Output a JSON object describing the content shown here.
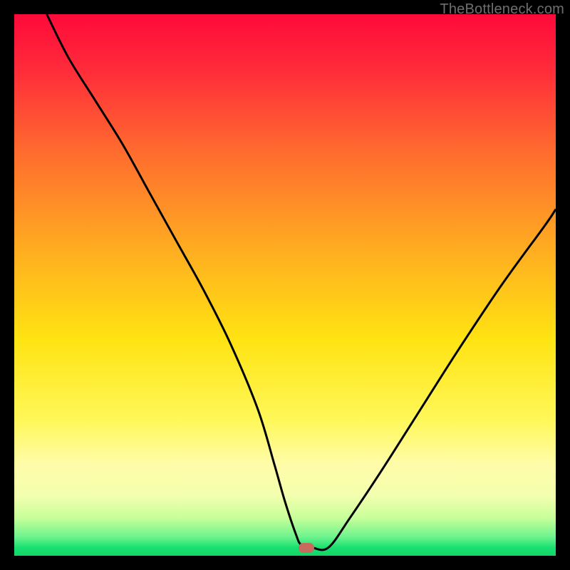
{
  "watermark": {
    "text": "TheBottleneck.com",
    "color": "#6f6f6f"
  },
  "chart_data": {
    "type": "line",
    "title": "",
    "xlabel": "",
    "ylabel": "",
    "xlim": [
      0,
      100
    ],
    "ylim": [
      0,
      100
    ],
    "grid": false,
    "legend": false,
    "gradient_stops": [
      {
        "pos": 0.0,
        "color": "#ff0a3a"
      },
      {
        "pos": 0.1,
        "color": "#ff2a3a"
      },
      {
        "pos": 0.25,
        "color": "#ff6a2f"
      },
      {
        "pos": 0.45,
        "color": "#ffb21f"
      },
      {
        "pos": 0.6,
        "color": "#ffe312"
      },
      {
        "pos": 0.75,
        "color": "#fff85a"
      },
      {
        "pos": 0.83,
        "color": "#fffca8"
      },
      {
        "pos": 0.89,
        "color": "#f2ffae"
      },
      {
        "pos": 0.93,
        "color": "#c8ff9a"
      },
      {
        "pos": 0.965,
        "color": "#6ef38d"
      },
      {
        "pos": 0.985,
        "color": "#18e06f"
      },
      {
        "pos": 1.0,
        "color": "#11d769"
      }
    ],
    "series": [
      {
        "name": "bottleneck-curve",
        "color": "#000000",
        "stroke_width": 3,
        "x": [
          6,
          10,
          15,
          20,
          25,
          30,
          35,
          40,
          45,
          48,
          50,
          52,
          53,
          55,
          58,
          62,
          68,
          75,
          82,
          90,
          98,
          100
        ],
        "y": [
          100,
          92,
          84,
          76,
          67,
          58,
          49,
          39,
          27,
          17,
          10,
          4,
          2,
          1.5,
          1.5,
          7,
          16,
          27,
          38,
          50,
          61,
          64
        ]
      }
    ],
    "marker": {
      "name": "optimal-point",
      "x": 54,
      "y": 1.5,
      "color": "#c96a5f"
    }
  }
}
